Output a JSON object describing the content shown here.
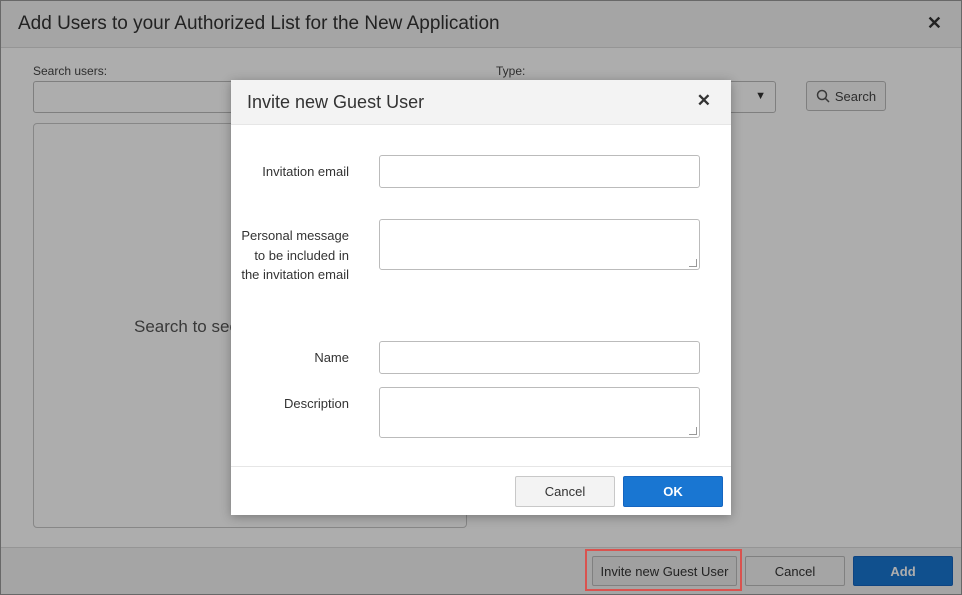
{
  "outer_dialog": {
    "title": "Add Users to your Authorized List for the New Application",
    "close_glyph": "✕",
    "search_label": "Search users:",
    "type_label": "Type:",
    "search_button_label": "Search",
    "results_text": "Search to see",
    "footer": {
      "invite_label": "Invite new Guest User",
      "cancel_label": "Cancel",
      "add_label": "Add"
    }
  },
  "modal": {
    "title": "Invite new Guest User",
    "close_glyph": "✕",
    "fields": {
      "invitation_email_label": "Invitation email",
      "personal_message_label": "Personal message to be included in the invitation email",
      "name_label": "Name",
      "description_label": "Description"
    },
    "cancel_label": "Cancel",
    "ok_label": "OK"
  },
  "icons": {
    "search": "search-icon",
    "caret": "chevron-down-icon",
    "close": "close-icon"
  },
  "colors": {
    "primary": "#1976d2",
    "highlight": "#d9534f"
  }
}
